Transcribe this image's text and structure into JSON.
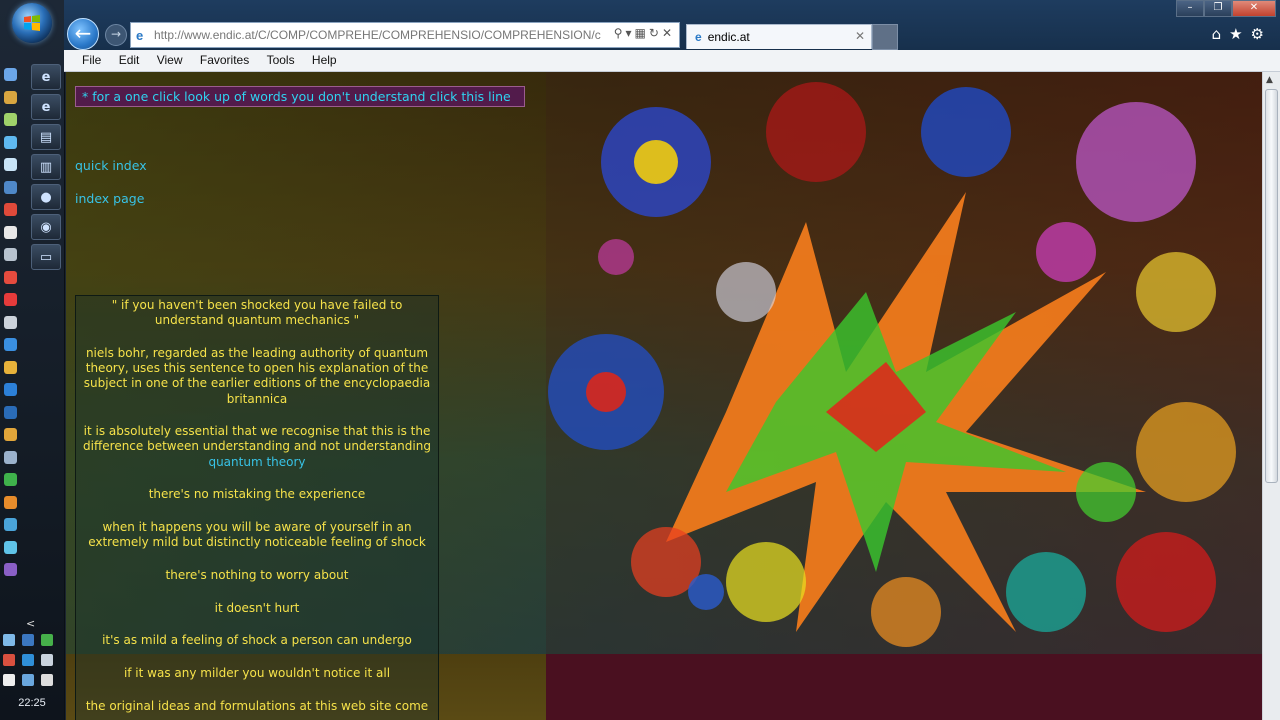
{
  "taskbar": {
    "clock": "22:25",
    "collapse_glyph": "<"
  },
  "browser": {
    "url": "http://www.endic.at/C/COMP/COMPREHE/COMPREHENSIO/COMPREHENSION/compre",
    "tab_title": "endic.at",
    "menu": [
      "File",
      "Edit",
      "View",
      "Favorites",
      "Tools",
      "Help"
    ]
  },
  "page": {
    "lookup_line": "* for a one click look up of words you don't understand click this line",
    "links": {
      "quick_index": "quick index",
      "index_page": "index page"
    },
    "quote": {
      "p1": "\" if you haven't been shocked you have failed to understand quantum mechanics \"",
      "p2": "niels bohr, regarded as the leading authority of quantum theory, uses this sentence to open his explanation of the subject in one of the earlier editions of the encyclopaedia britannica",
      "p3_text": "it is absolutely essential that we recognise that this is the difference between understanding and not understanding ",
      "p3_link": "quantum theory",
      "p4": "there's no mistaking the experience",
      "p5": "when it happens you will be aware of yourself in an extremely mild but distinctly noticeable feeling of shock",
      "p6": "there's nothing to worry about",
      "p7": "it doesn't hurt",
      "p8": "it's as mild a feeling of shock a person can undergo",
      "p9": "if it was any milder you wouldn't notice it all",
      "p10": "the original ideas and formulations at this web site come"
    }
  },
  "colors": {
    "quote_text": "#f6e24a",
    "link": "#38c3e6",
    "lookup_bg": "#521b4b"
  }
}
